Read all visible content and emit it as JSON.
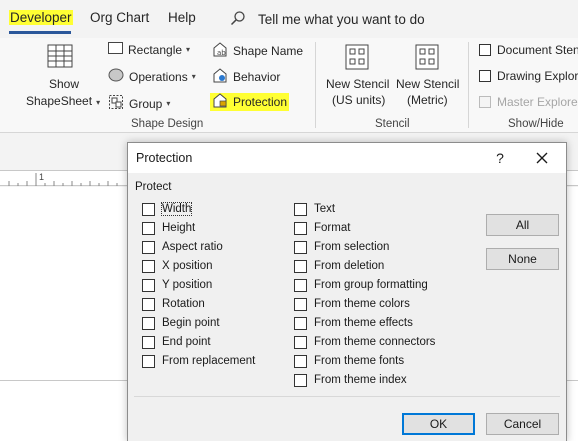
{
  "tabs": {
    "developer": "Developer",
    "org_chart": "Org Chart",
    "help": "Help",
    "tell_me": "Tell me what you want to do"
  },
  "ribbon": {
    "show_shapesheet": [
      "Show",
      "ShapeSheet"
    ],
    "rectangle": "Rectangle",
    "operations": "Operations",
    "group": "Group",
    "shape_name": "Shape Name",
    "behavior": "Behavior",
    "protection": "Protection",
    "shape_design_label": "Shape Design",
    "new_stencil_us": [
      "New Stencil",
      "(US units)"
    ],
    "new_stencil_metric": [
      "New Stencil",
      "(Metric)"
    ],
    "stencil_label": "Stencil",
    "document_stencil": "Document Sten",
    "drawing_explorer": "Drawing Explore",
    "master_explorer": "Master Explorer",
    "show_hide_label": "Show/Hide"
  },
  "ruler": {
    "mark_1": "1"
  },
  "dialog": {
    "title": "Protection",
    "help": "?",
    "protect_label": "Protect",
    "left_options": [
      "Width",
      "Height",
      "Aspect ratio",
      "X position",
      "Y position",
      "Rotation",
      "Begin point",
      "End point",
      "From replacement"
    ],
    "right_options": [
      "Text",
      "Format",
      "From selection",
      "From deletion",
      "From group formatting",
      "From theme colors",
      "From theme effects",
      "From theme connectors",
      "From theme fonts",
      "From theme index"
    ],
    "all_button": "All",
    "none_button": "None",
    "ok_button": "OK",
    "cancel_button": "Cancel"
  },
  "colors": {
    "highlight": "#ffff33",
    "accent": "#2b579a",
    "default_button_border": "#0078d7"
  }
}
